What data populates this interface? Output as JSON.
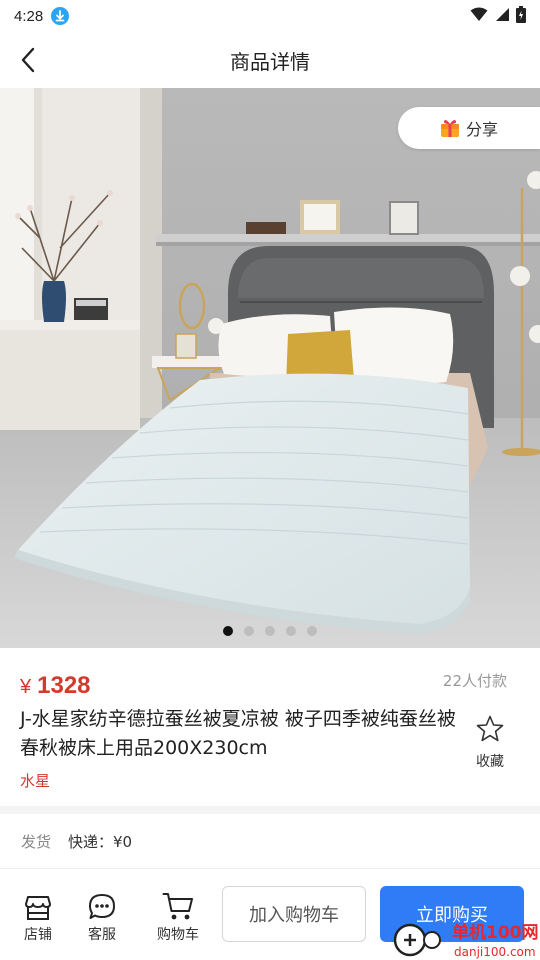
{
  "status_bar": {
    "time": "4:28"
  },
  "header": {
    "title": "商品详情"
  },
  "hero": {
    "share_label": "分享",
    "carousel": {
      "total": 5,
      "active_index": 0
    }
  },
  "product": {
    "currency": "¥",
    "price": "1328",
    "sold": "22人付款",
    "name": "J-水星家纺辛德拉蚕丝被夏凉被 被子四季被纯蚕丝被春秋被床上用品200X230cm",
    "favorite_label": "收藏",
    "brand": "水星"
  },
  "shipping": {
    "label": "发货",
    "value": "快递：¥0"
  },
  "bottom_bar": {
    "shop_label": "店铺",
    "service_label": "客服",
    "cart_label": "购物车",
    "add_to_cart": "加入购物车",
    "buy_now": "立即购买"
  },
  "watermark": {
    "site_cn": "单机100网",
    "site_url": "danji100.com"
  },
  "colors": {
    "price_red": "#d33a2c",
    "primary_blue": "#2f7cf6",
    "share_gift": "#f5a623"
  }
}
